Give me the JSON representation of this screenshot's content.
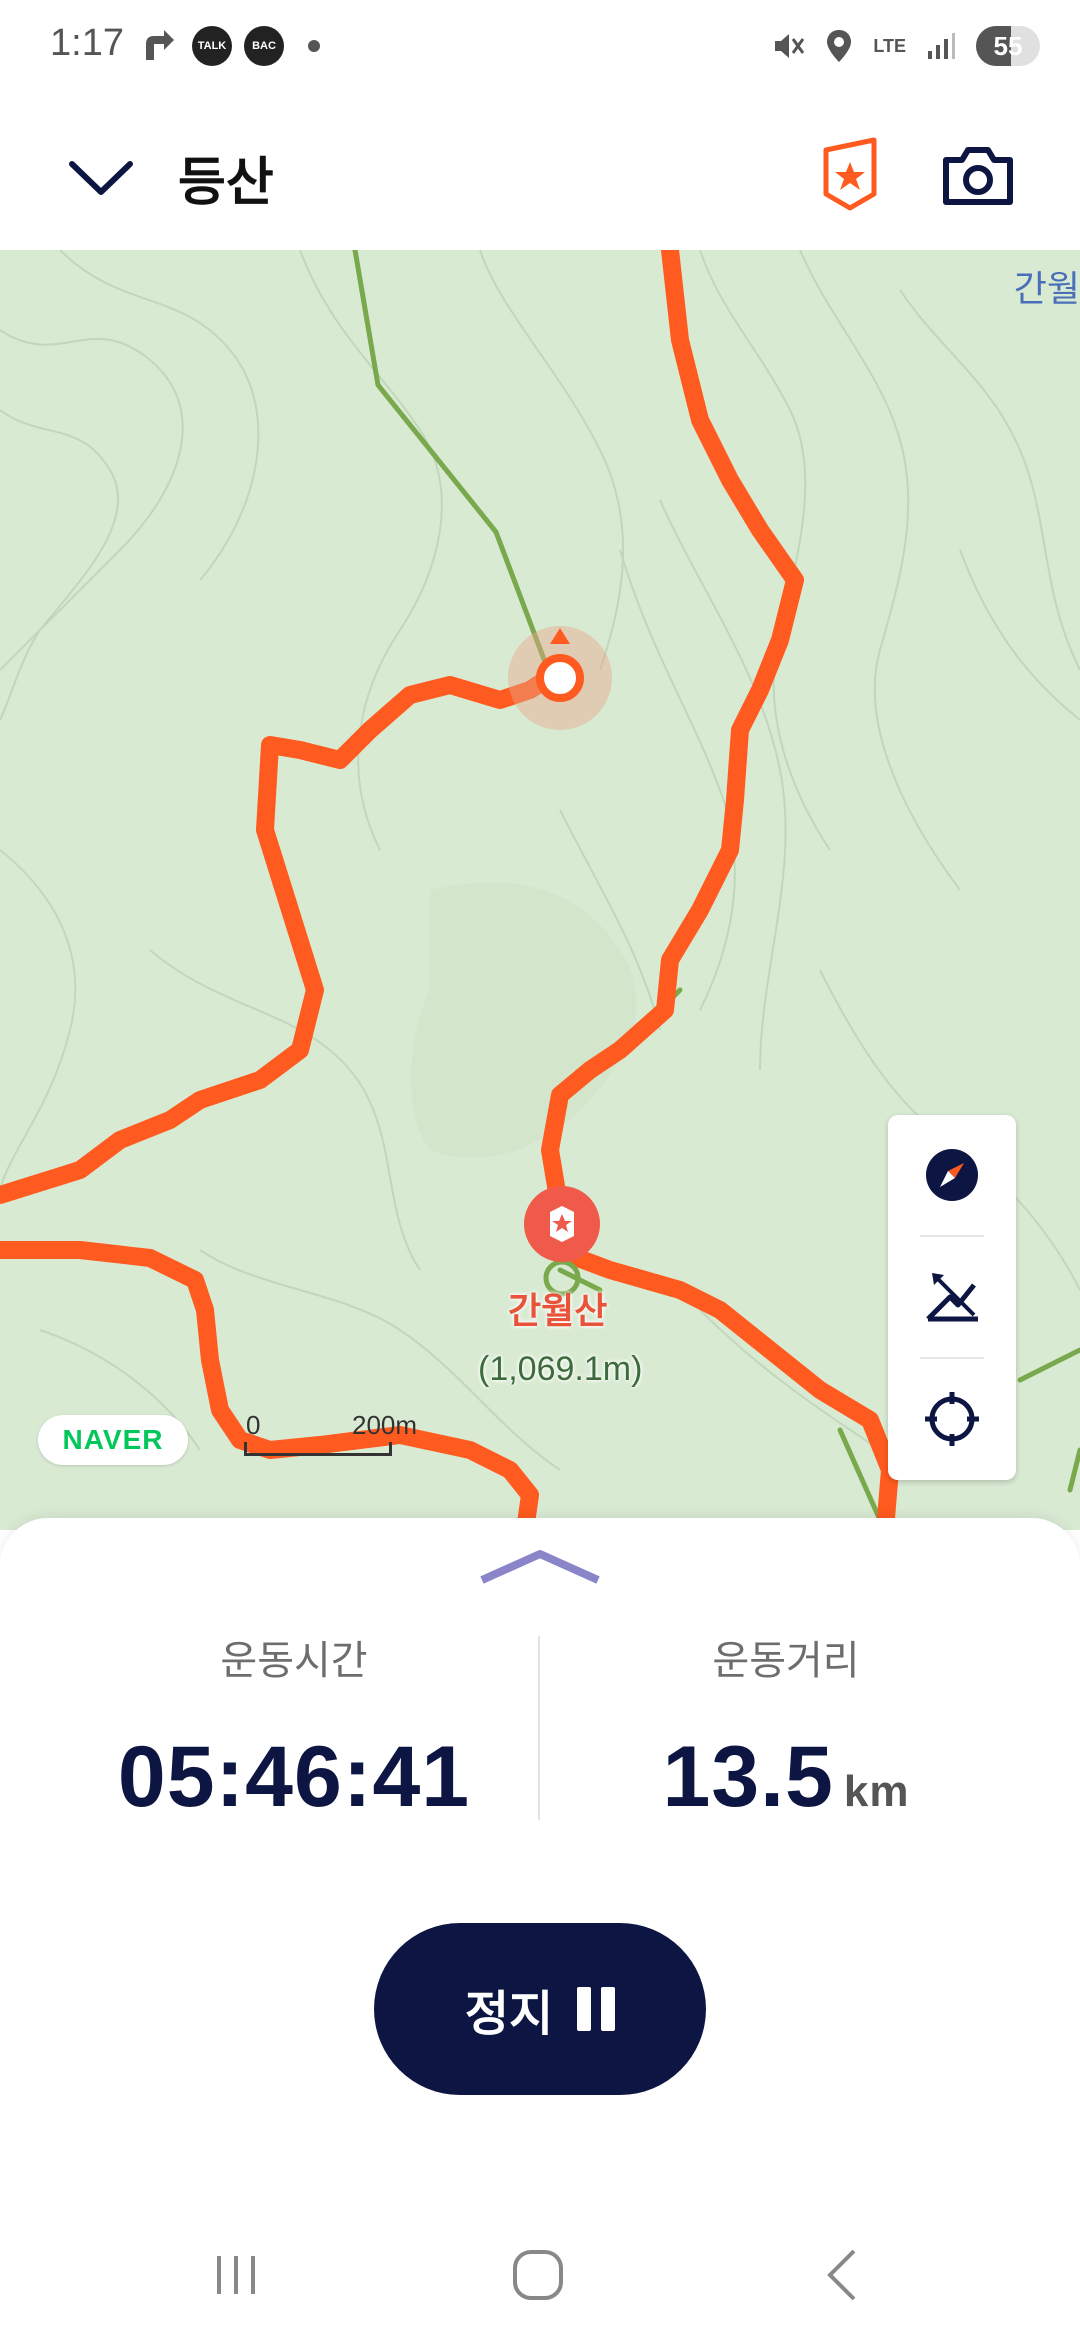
{
  "status_bar": {
    "time": "1:17",
    "notif_icons": [
      "navigation-icon",
      "talk-icon",
      "bac-icon"
    ],
    "talk_label": "TALK",
    "bac_label": "BAC",
    "network": "LTE",
    "battery_level": "55"
  },
  "header": {
    "title": "등산",
    "icons": [
      "chevron-down-icon",
      "badge-star-icon",
      "camera-icon"
    ]
  },
  "map": {
    "peak_name": "간월산",
    "peak_elevation": "(1,069.1m)",
    "corner_label": "간월",
    "provider": "NAVER",
    "scale_start": "0",
    "scale_end": "200m",
    "tools": [
      "compass-icon",
      "elevation-toggle-icon",
      "locate-icon"
    ],
    "colors": {
      "route": "#ff5a1f",
      "trail": "#7aa84c",
      "map_bg": "#d9ead3"
    }
  },
  "stats": {
    "time_label": "운동시간",
    "time_value": "05:46:41",
    "distance_label": "운동거리",
    "distance_value": "13.5",
    "distance_unit": "km"
  },
  "actions": {
    "stop_label": "정지"
  },
  "nav": {
    "icons": [
      "recent-apps-icon",
      "home-icon",
      "back-icon"
    ]
  },
  "theme": {
    "primary": "#0d1642",
    "accent": "#ff5a1f"
  }
}
